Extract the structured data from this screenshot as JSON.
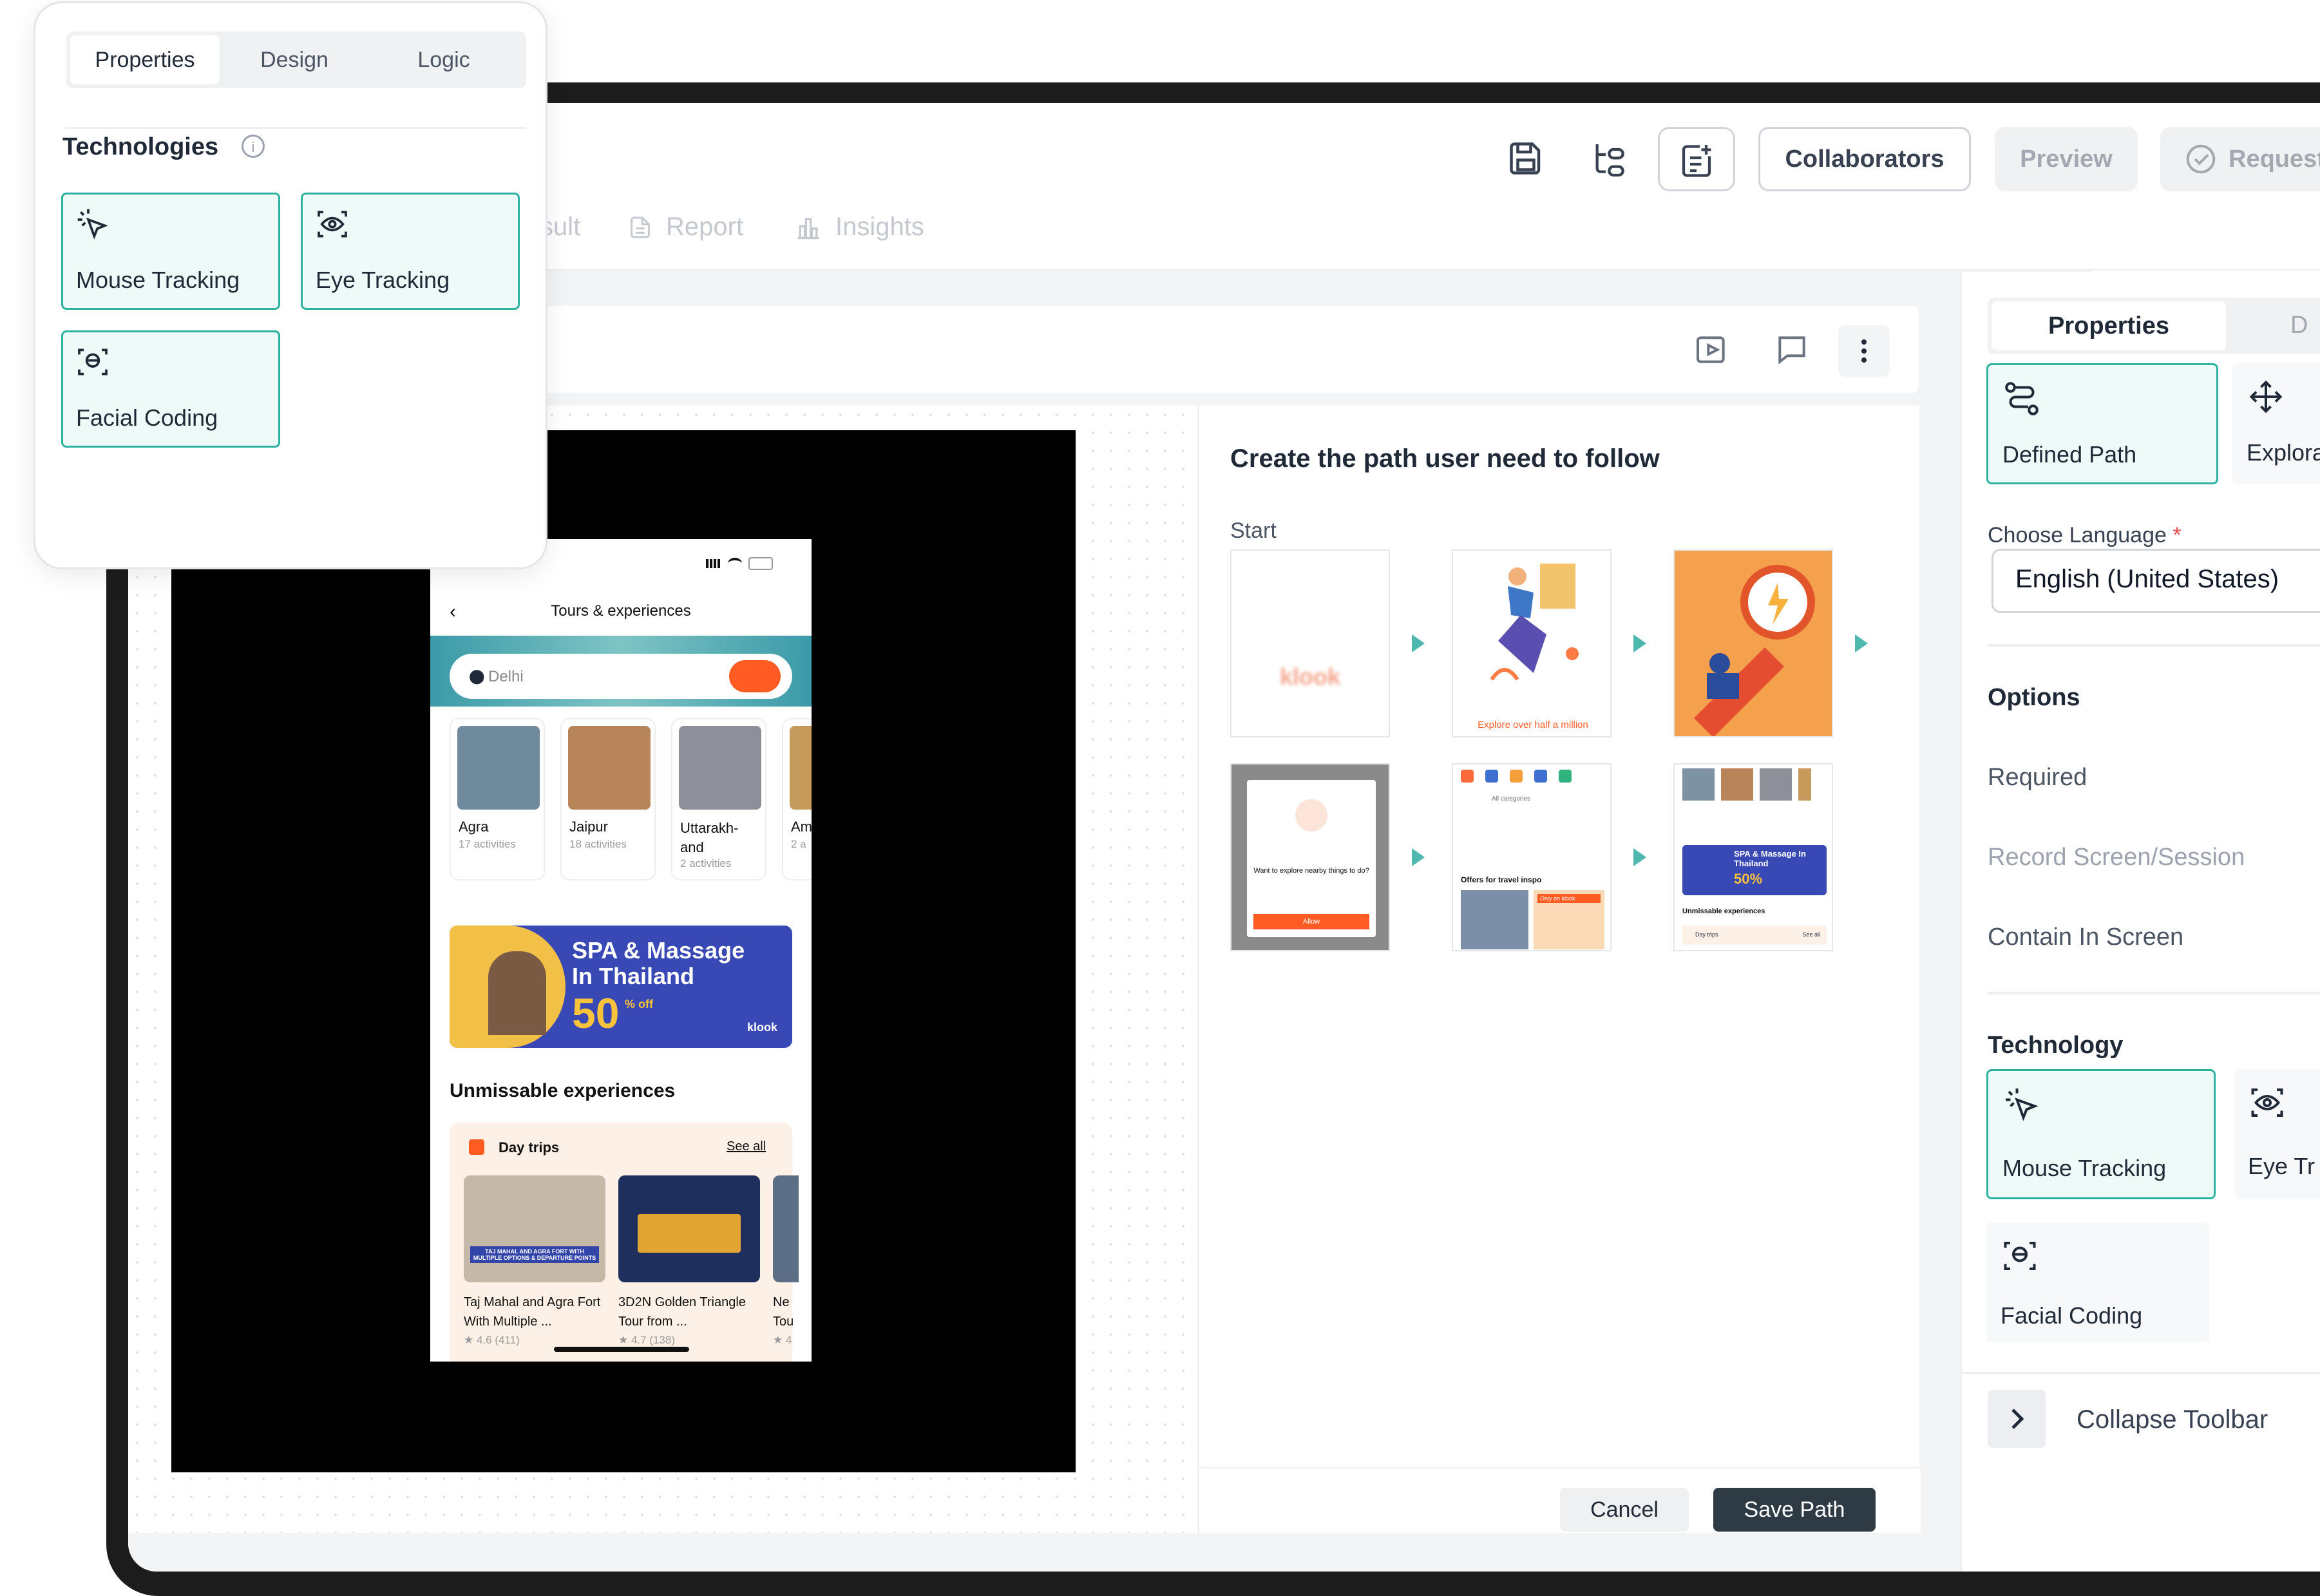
{
  "popup": {
    "tabs": [
      "Properties",
      "Design",
      "Logic"
    ],
    "section_title": "Technologies",
    "cards": [
      "Mouse Tracking",
      "Eye Tracking",
      "Facial Coding"
    ]
  },
  "header": {
    "collaborators": "Collaborators",
    "preview": "Preview",
    "request": "Request",
    "nav": {
      "result_partial": "sult",
      "report": "Report",
      "insights": "Insights"
    }
  },
  "path_panel": {
    "title": "Create the path user need to follow",
    "start_label": "Start",
    "cancel": "Cancel",
    "save": "Save Path",
    "thumbs": {
      "welcome_brand": "klook",
      "explore_caption": "Explore over half a million",
      "location_q": "Want to explore nearby things to do?",
      "allow": "Allow",
      "offers": "Offers for travel inspo",
      "all_categories": "All categories",
      "only_on_klook": "Only on klook",
      "promo_small": "SPA & Massage In Thailand",
      "promo_small_pct": "50%",
      "unmissable_small": "Unmissable experiences",
      "day_trips_small": "Day trips",
      "see_all_small": "See all"
    }
  },
  "phone": {
    "title": "Tours & experiences",
    "search_value": "Delhi",
    "cities": [
      {
        "name": "Agra",
        "sub": "17 activities"
      },
      {
        "name": "Jaipur",
        "sub": "18 activities"
      },
      {
        "name": "Uttarakh-and",
        "sub": "2 activities"
      },
      {
        "name": "Am",
        "sub": "2 a"
      }
    ],
    "promo": {
      "line1": "SPA & Massage",
      "line2": "In Thailand",
      "pct": "50",
      "off": "% off",
      "brand": "klook"
    },
    "section": "Unmissable experiences",
    "day_trips": "Day trips",
    "see_all": "See all",
    "tajmahal_banner": "TAJ MAHAL AND AGRA FORT WITH MULTIPLE OPTIONS & DEPARTURE POINTS",
    "trips": [
      {
        "title": "Taj Mahal and Agra Fort With Multiple ...",
        "rating": "★ 4.6 (411)"
      },
      {
        "title": "3D2N Golden Triangle Tour from ...",
        "rating": "★ 4.7 (138)"
      },
      {
        "title": "Ne Tou",
        "rating": "★ 4"
      }
    ]
  },
  "right_panel": {
    "tabs": [
      "Properties",
      "D"
    ],
    "modes": [
      "Defined Path",
      "Explora"
    ],
    "language_label": "Choose Language",
    "required_mark": "*",
    "language_value": "English (United States)",
    "options_title": "Options",
    "options": [
      "Required",
      "Record Screen/Session",
      "Contain In Screen"
    ],
    "technology_title": "Technology",
    "tech_cards": [
      "Mouse Tracking",
      "Eye Tr",
      "Facial Coding"
    ],
    "collapse": "Collapse Toolbar"
  }
}
